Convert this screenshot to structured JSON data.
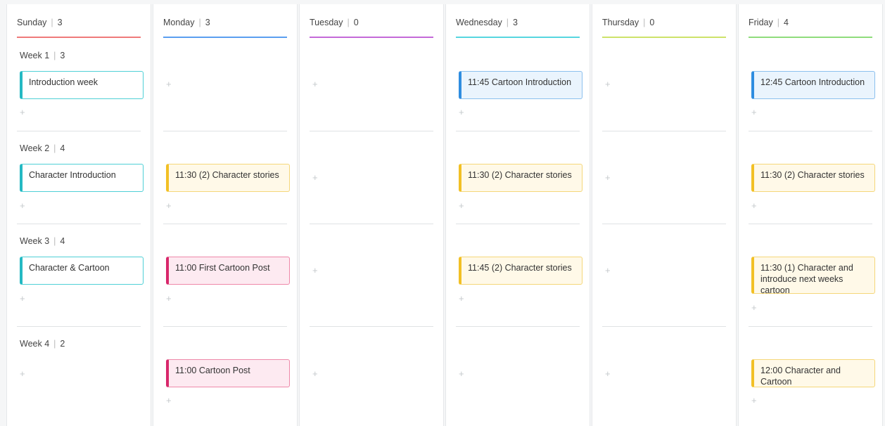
{
  "days": [
    {
      "name": "Sunday",
      "count": "3",
      "color": "#ef7a7a"
    },
    {
      "name": "Monday",
      "count": "3",
      "color": "#5b9ff0"
    },
    {
      "name": "Tuesday",
      "count": "0",
      "color": "#c46ad8"
    },
    {
      "name": "Wednesday",
      "count": "3",
      "color": "#57d6e0"
    },
    {
      "name": "Thursday",
      "count": "0",
      "color": "#cde36a"
    },
    {
      "name": "Friday",
      "count": "4",
      "color": "#8fdc7c"
    }
  ],
  "weeks": [
    {
      "label": "Week 1",
      "count": "3"
    },
    {
      "label": "Week 2",
      "count": "4"
    },
    {
      "label": "Week 3",
      "count": "4"
    },
    {
      "label": "Week 4",
      "count": "2"
    }
  ],
  "add_glyph": "+",
  "cards": {
    "sun_w1": "Introduction week",
    "sun_w2": "Character Introduction",
    "sun_w3": "Character & Cartoon",
    "mon_w2": "11:30 (2) Character stories",
    "mon_w3": "11:00 First Cartoon Post",
    "mon_w4": "11:00 Cartoon Post",
    "wed_w1": "11:45 Cartoon Introduction",
    "wed_w2": "11:30 (2) Character stories",
    "wed_w3": "11:45 (2) Character stories",
    "fri_w1": "12:45 Cartoon Introduction",
    "fri_w2": "11:30 (2) Character stories",
    "fri_w3": "11:30 (1) Character and introduce next weeks cartoon",
    "fri_w4": "12:00 Character and Cartoon"
  }
}
